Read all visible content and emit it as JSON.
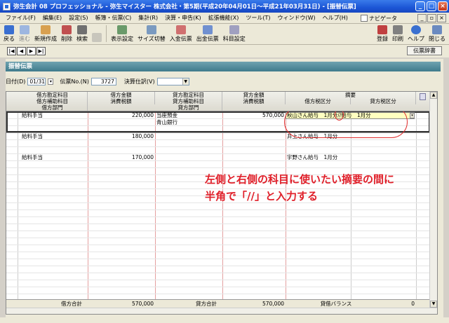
{
  "window": {
    "title": "弥生会計 08 プロフェッショナル - 弥生マイスター 株式会社・第5期(平成20年04月01日～平成21年03月31日) - [振替伝票]"
  },
  "menu": [
    "ファイル(F)",
    "編集(E)",
    "設定(S)",
    "帳簿・伝票(C)",
    "集計(R)",
    "決算・申告(K)",
    "拡張機能(X)",
    "ツール(T)",
    "ウィンドウ(W)",
    "ヘルプ(H)"
  ],
  "navi_label": "ナビゲータ",
  "toolbar": {
    "left": [
      "戻る",
      "進む",
      "新規作成",
      "削除",
      "検索",
      "",
      "表示設定",
      "サイズ切替",
      "入金伝票",
      "出金伝票",
      "科目設定"
    ],
    "right": [
      "登録",
      "印刷",
      "ヘルプ",
      "閉じる"
    ]
  },
  "dict_button": "伝票辞書",
  "section_title": "振替伝票",
  "form": {
    "date_label": "日付(D)",
    "date_value": "01/31",
    "no_label": "伝票No.(N)",
    "no_value": "3727",
    "type_label": "決算仕訳(V)",
    "type_value": ""
  },
  "headers": {
    "debit_account": "借方勘定科目",
    "debit_sub": "借方補助科目",
    "debit_dept": "借方部門",
    "debit_amount": "借方金額",
    "debit_tax": "消費税額",
    "credit_account": "貸方勘定科目",
    "credit_sub": "貸方補助科目",
    "credit_dept": "貸方部門",
    "credit_amount": "貸方金額",
    "credit_tax": "消費税額",
    "memo": "摘要",
    "debit_taxclass": "借方税区分",
    "credit_taxclass": "貸方税区分"
  },
  "rows": [
    {
      "debit_account": "給料手当",
      "debit_amount": "220,000",
      "credit_account": "当座預金",
      "credit_sub": "青山銀行",
      "credit_amount": "570,000",
      "memo": "秋山さん給与　1月分//給与　1月分"
    },
    {
      "debit_account": "給料手当",
      "debit_amount": "180,000",
      "credit_account": "",
      "credit_sub": "",
      "credit_amount": "",
      "memo": "井上さん給与　1月分"
    },
    {
      "debit_account": "給料手当",
      "debit_amount": "170,000",
      "credit_account": "",
      "credit_sub": "",
      "credit_amount": "",
      "memo": "宇野さん給与　1月分"
    }
  ],
  "footer": {
    "debit_total_label": "借方合計",
    "debit_total": "570,000",
    "credit_total_label": "貸方合計",
    "credit_total": "570,000",
    "balance_label": "貸借バランス",
    "balance": "0"
  },
  "annotation": {
    "line1": "左側と右側の科目に使いたい摘要の間に",
    "line2": "半角で「//」と入力する"
  },
  "colors": {
    "annotation": "#e0202a",
    "section": "#4f8a9a",
    "titlebar": "#1c56d6"
  }
}
